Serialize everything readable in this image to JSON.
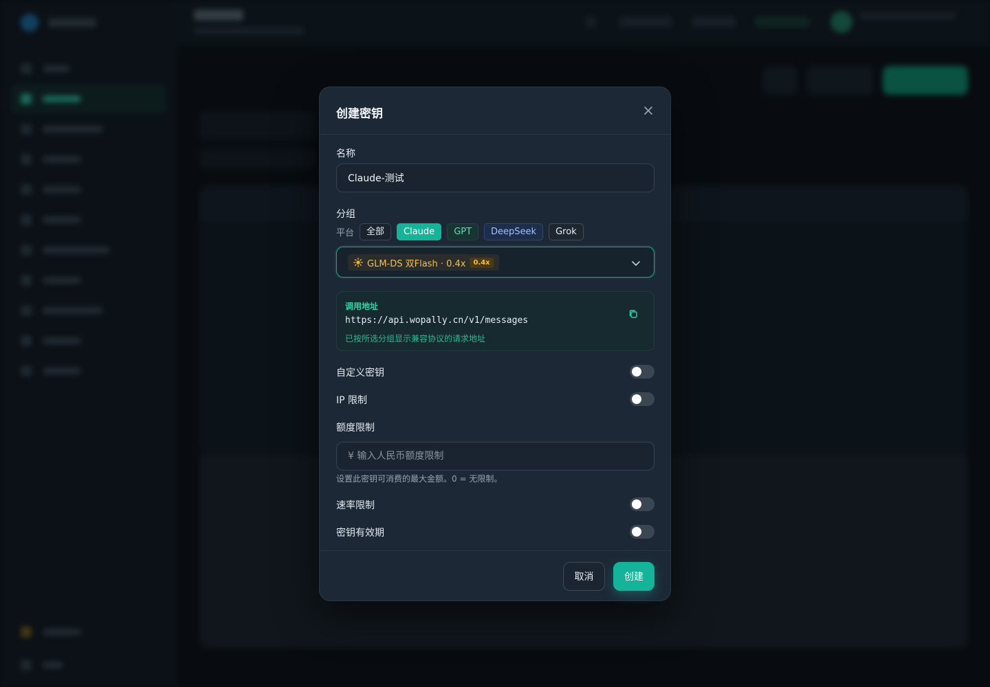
{
  "modal": {
    "title": "创建密钥",
    "name_label": "名称",
    "name_value": "Claude-测试",
    "group_label": "分组",
    "platform_label": "平台",
    "platforms": [
      {
        "label": "全部",
        "state": "default"
      },
      {
        "label": "Claude",
        "state": "selected"
      },
      {
        "label": "GPT",
        "state": "default"
      },
      {
        "label": "DeepSeek",
        "state": "default"
      },
      {
        "label": "Grok",
        "state": "default"
      }
    ],
    "group_select": {
      "icon": "sun-icon",
      "value": "GLM-DS 双Flash · 0.4x",
      "badge": "0.4x"
    },
    "endpoint": {
      "label": "调用地址",
      "url": "https://api.wopally.cn/v1/messages",
      "note": "已按所选分组显示兼容协议的请求地址"
    },
    "custom_key_label": "自定义密钥",
    "ip_limit_label": "IP 限制",
    "quota_label": "额度限制",
    "quota_placeholder": "¥ 输入人民币额度限制",
    "quota_hint": "设置此密钥可消费的最大金额。0 = 无限制。",
    "rate_limit_label": "速率限制",
    "expiry_label": "密钥有效期",
    "toggles": {
      "custom_key": false,
      "ip_limit": false,
      "rate_limit": false,
      "expiry": false
    },
    "cancel_label": "取消",
    "create_label": "创建"
  },
  "colors": {
    "accent": "#14b39a",
    "modal_bg": "#1d2836",
    "page_bg": "#0b1017",
    "warning_text": "#f0c155"
  }
}
